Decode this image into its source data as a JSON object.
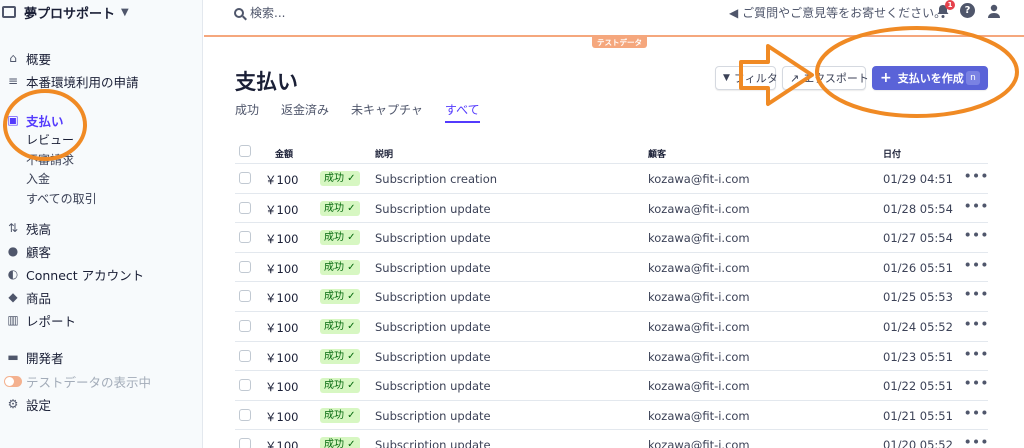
{
  "account": {
    "name": "夢プロサポート"
  },
  "sidebar": {
    "items": [
      {
        "label": "概要",
        "icon": "home-icon"
      },
      {
        "label": "本番環境利用の申請",
        "icon": "checklist-icon"
      },
      {
        "label": "支払い",
        "icon": "wallet-icon"
      },
      {
        "label": "残高",
        "icon": "balance-icon"
      },
      {
        "label": "顧客",
        "icon": "customer-icon"
      },
      {
        "label": "Connect アカウント",
        "icon": "connect-icon"
      },
      {
        "label": "商品",
        "icon": "product-icon"
      },
      {
        "label": "レポート",
        "icon": "report-icon"
      },
      {
        "label": "開発者",
        "icon": "terminal-icon"
      },
      {
        "label": "テストデータの表示中",
        "icon": "toggle-icon"
      },
      {
        "label": "設定",
        "icon": "gear-icon"
      }
    ],
    "payment_subitems": [
      "レビュー",
      "不審請求",
      "入金",
      "すべての取引"
    ]
  },
  "topbar": {
    "search_placeholder": "検索...",
    "feedback": "ご質問やご意見等をお寄せください。",
    "notification_count": "1",
    "help": "?"
  },
  "test_tag": "テストデータ",
  "page": {
    "title": "支払い",
    "tabs": [
      "成功",
      "返金済み",
      "未キャプチャ",
      "すべて"
    ],
    "active_tab": "すべて",
    "filter_button": "フィルタ",
    "export_button": "エクスポート",
    "create_button": "支払いを作成",
    "create_shortcut": "n"
  },
  "table": {
    "headers": [
      "金額",
      "説明",
      "顧客",
      "日付"
    ],
    "rows": [
      {
        "amount": "￥100",
        "status": "成功 ✓",
        "description": "Subscription creation",
        "customer": "kozawa@fit-i.com",
        "date": "01/29 04:51"
      },
      {
        "amount": "￥100",
        "status": "成功 ✓",
        "description": "Subscription update",
        "customer": "kozawa@fit-i.com",
        "date": "01/28 05:54"
      },
      {
        "amount": "￥100",
        "status": "成功 ✓",
        "description": "Subscription update",
        "customer": "kozawa@fit-i.com",
        "date": "01/27 05:54"
      },
      {
        "amount": "￥100",
        "status": "成功 ✓",
        "description": "Subscription update",
        "customer": "kozawa@fit-i.com",
        "date": "01/26 05:51"
      },
      {
        "amount": "￥100",
        "status": "成功 ✓",
        "description": "Subscription update",
        "customer": "kozawa@fit-i.com",
        "date": "01/25 05:53"
      },
      {
        "amount": "￥100",
        "status": "成功 ✓",
        "description": "Subscription update",
        "customer": "kozawa@fit-i.com",
        "date": "01/24 05:52"
      },
      {
        "amount": "￥100",
        "status": "成功 ✓",
        "description": "Subscription update",
        "customer": "kozawa@fit-i.com",
        "date": "01/23 05:51"
      },
      {
        "amount": "￥100",
        "status": "成功 ✓",
        "description": "Subscription update",
        "customer": "kozawa@fit-i.com",
        "date": "01/22 05:51"
      },
      {
        "amount": "￥100",
        "status": "成功 ✓",
        "description": "Subscription update",
        "customer": "kozawa@fit-i.com",
        "date": "01/21 05:51"
      },
      {
        "amount": "￥100",
        "status": "成功 ✓",
        "description": "Subscription update",
        "customer": "kozawa@fit-i.com",
        "date": "01/20 05:52"
      }
    ]
  },
  "colors": {
    "accent": "#533afd",
    "annotation": "#f08a24",
    "success_bg": "#d7f7c2",
    "test_orange": "#f5a77d"
  }
}
